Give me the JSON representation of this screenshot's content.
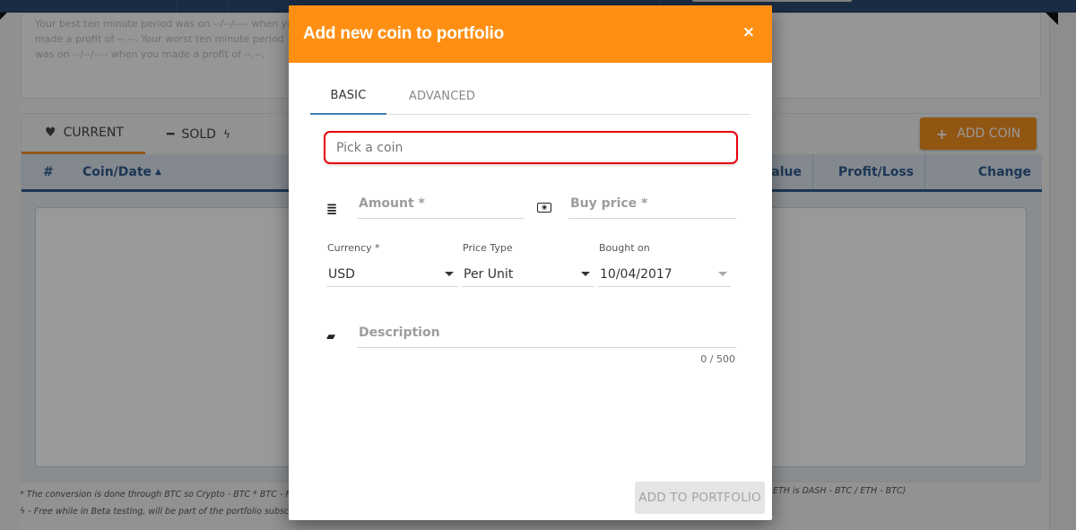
{
  "background": {
    "stats_text": "Your best ten minute period was on --/--/---- when you made a profit of --.--. Your worst ten minute period was on --/--/---- when you made a profit of --.--.",
    "tabs": [
      {
        "label": "CURRENT",
        "icon": "heartbeat-icon",
        "active": true
      },
      {
        "label": "SOLD",
        "icon": "minus-icon",
        "suffix_icon": "bolt-icon",
        "active": false
      }
    ],
    "add_coin_label": "ADD COIN",
    "table_headers": [
      "#",
      "Coin/Date",
      "Value",
      "Profit/Loss",
      "Change"
    ],
    "sort_indicator": "▲",
    "footnote_1": "* The conversion is done through BTC so Crypto - BTC * BTC - FIAT, crypto to crypto e.g. DASH to ETH is DASH - BTC / ETH - BTC)",
    "footnote_1_visible_left": "* The conversion is done through BTC so Crypto - BTC * BTC - FIA",
    "footnote_1_visible_right": "ETH is DASH - BTC / ETH - BTC)",
    "footnote_2": "- Free while in Beta testing, will be part of the portfolio subscrip"
  },
  "modal": {
    "title": "Add new coin to portfolio",
    "close_label": "×",
    "tabs": [
      {
        "label": "BASIC",
        "active": true
      },
      {
        "label": "ADVANCED",
        "active": false
      }
    ],
    "coin_picker": {
      "placeholder": "Pick a coin",
      "value": ""
    },
    "amount": {
      "placeholder": "Amount *",
      "value": "",
      "icon": "list-icon"
    },
    "buy_price": {
      "placeholder": "Buy price *",
      "value": "",
      "icon": "money-icon"
    },
    "currency": {
      "label": "Currency *",
      "value": "USD"
    },
    "price_type": {
      "label": "Price Type",
      "value": "Per Unit"
    },
    "bought_on": {
      "label": "Bought on",
      "value": "10/04/2017"
    },
    "description": {
      "placeholder": "Description",
      "value": "",
      "icon": "book-icon",
      "counter": "0 / 500"
    },
    "submit_label": "ADD TO PORTFOLIO",
    "colors": {
      "header": "#ff8f13",
      "highlight_border": "#e8000b",
      "active_tab": "#3e7bb6"
    }
  }
}
